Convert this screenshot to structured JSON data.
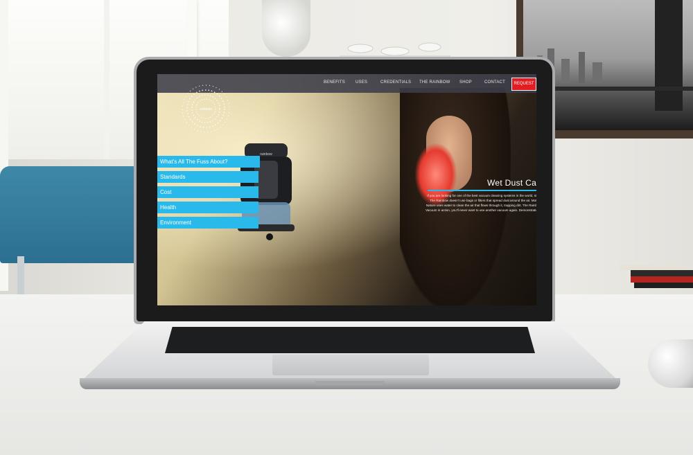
{
  "scene": {
    "description_colors": {
      "accent": "#29b9ea",
      "request": "#e31b23",
      "nav_bg": "#3c3e4a"
    }
  },
  "website": {
    "nav": {
      "items": [
        "BENEFITS",
        "USES",
        "CREDENTIALS",
        "THE RAINBOW",
        "SHOP",
        "CONTACT"
      ],
      "request_label": "REQUEST"
    },
    "logo": {
      "text": "rainbow",
      "icon": "dotted-sunburst-icon"
    },
    "product_label": "rainbow",
    "sidebar": [
      "What's All The Fuss About?",
      "Standards",
      "Cost",
      "Health",
      "Environment"
    ],
    "hero": {
      "title": "Wet Dust Can't",
      "body": "If you are looking for one of the best vacuum cleaning systems in the world, start. The Rainbow doesn't use bags or filters that spread dust around the air. Mother Nature uses water to clean the air that flows through it, trapping dirt. The Rainbow Vacuum in action, you'll never want to use another vacuum again. Demonstration?"
    }
  }
}
